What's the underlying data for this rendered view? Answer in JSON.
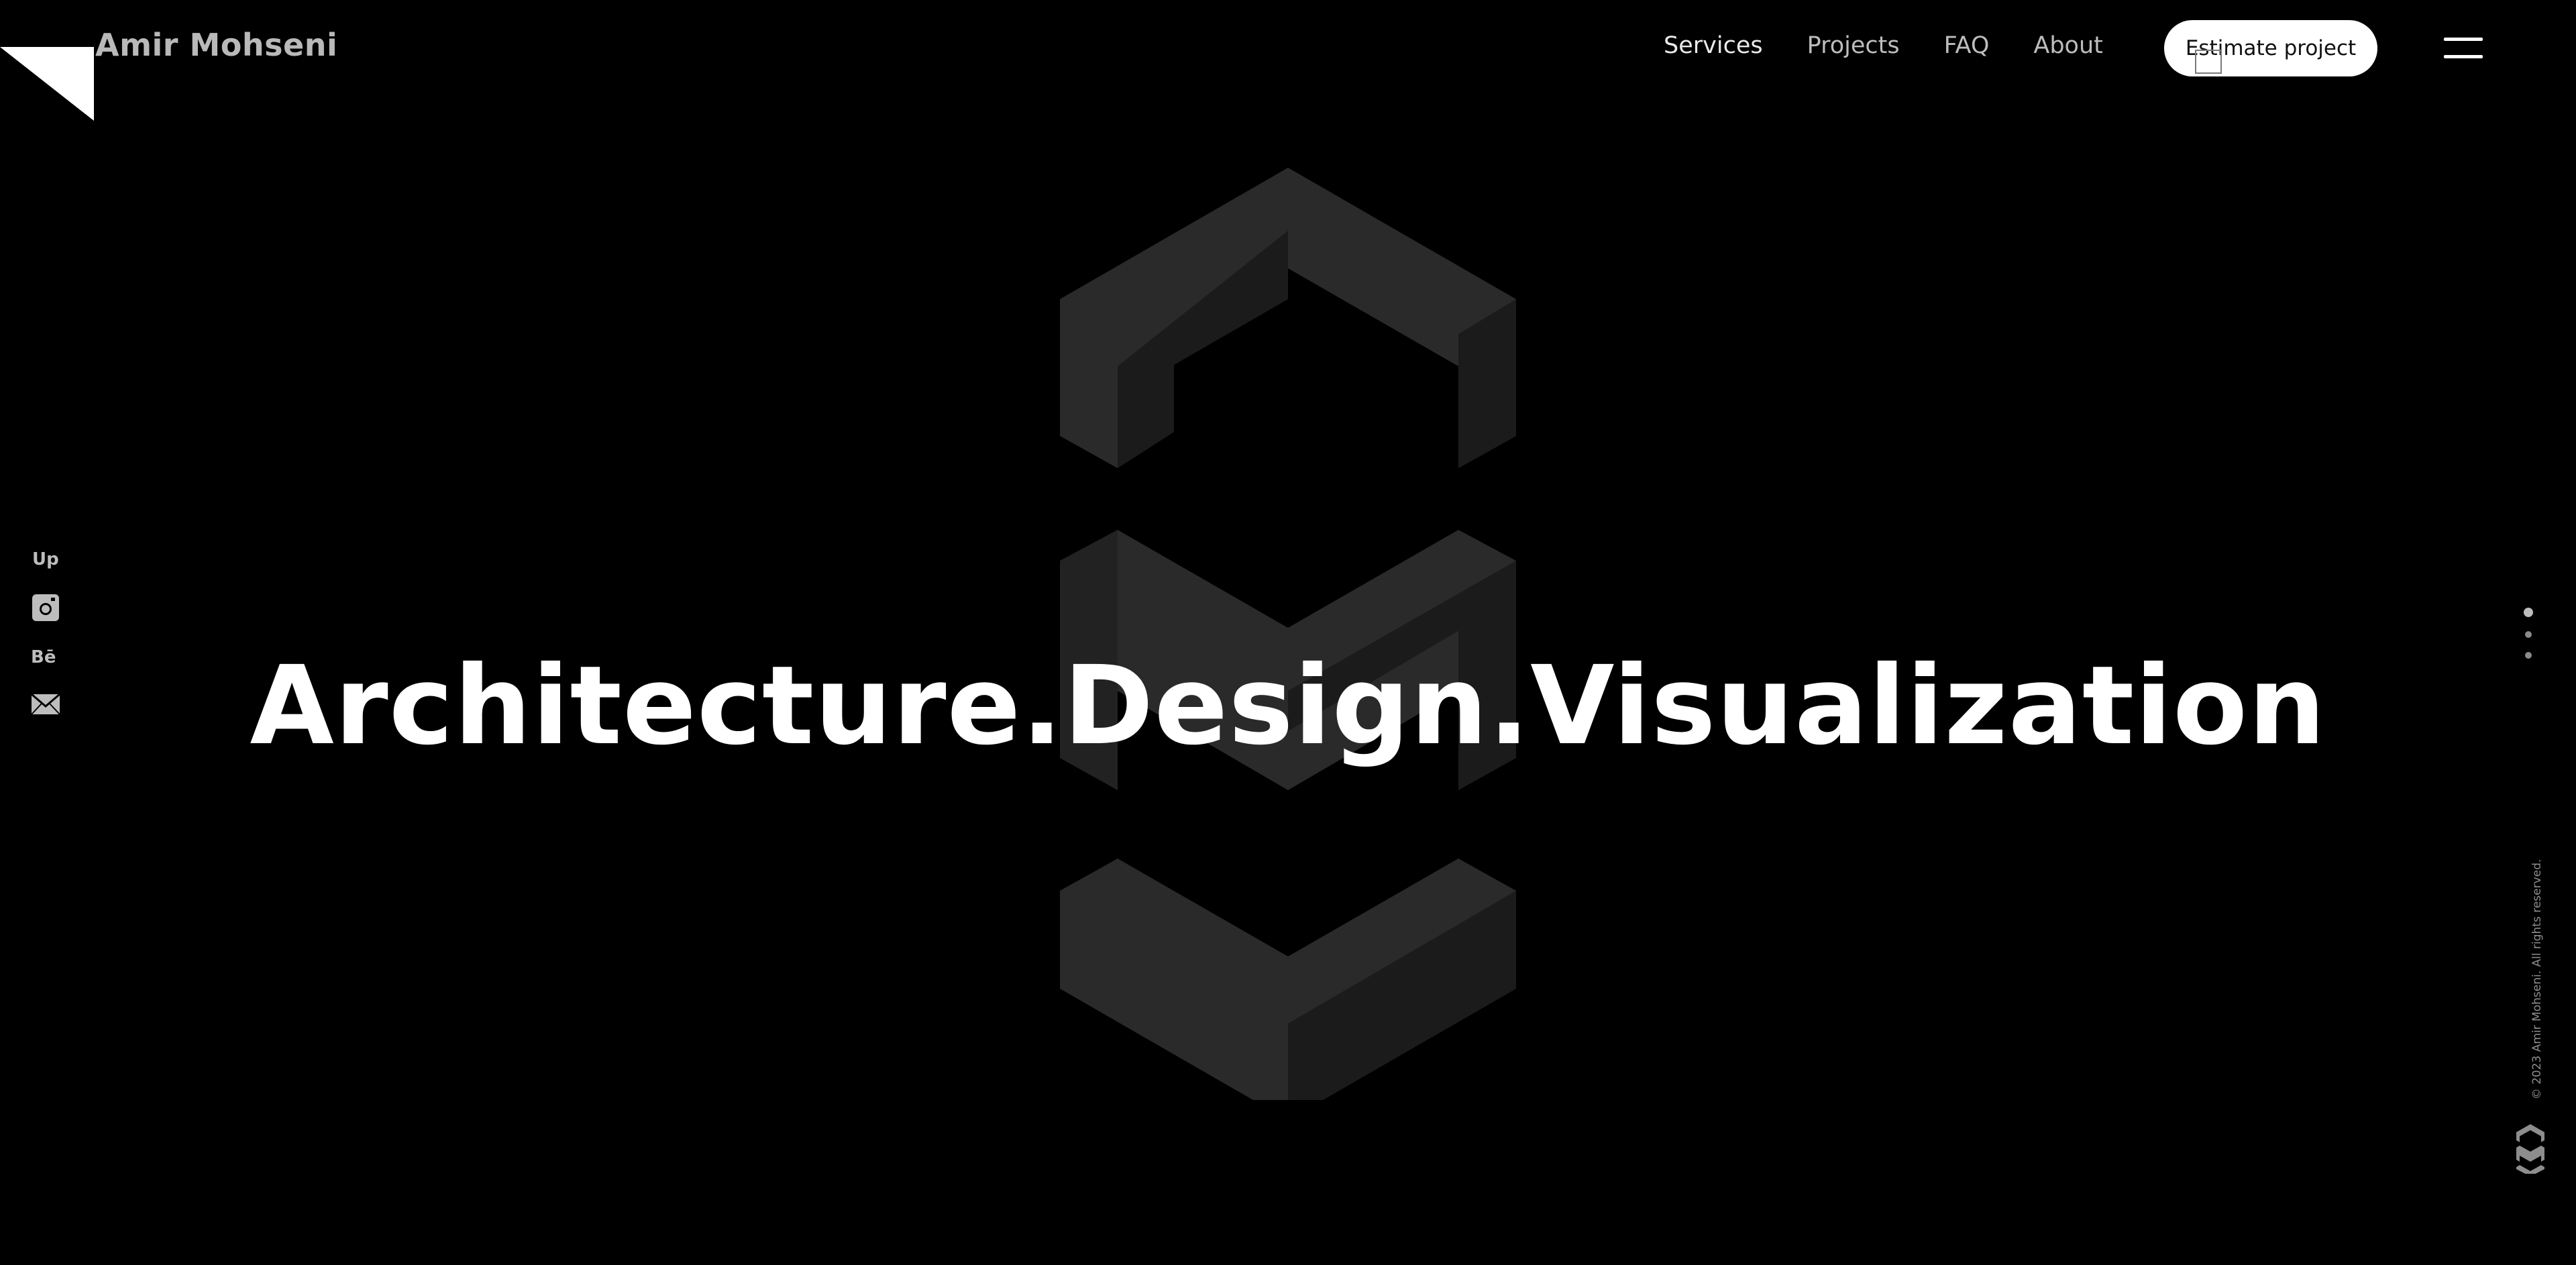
{
  "header": {
    "brand": "Amir Mohseni",
    "nav": [
      {
        "label": "Services"
      },
      {
        "label": "Projects"
      },
      {
        "label": "FAQ"
      },
      {
        "label": "About"
      }
    ],
    "cta_label": "Estimate project"
  },
  "hero": {
    "title": "Architecture.Design.Visualization"
  },
  "social": [
    {
      "icon": "upwork-icon",
      "label": "Up"
    },
    {
      "icon": "instagram-icon"
    },
    {
      "icon": "behance-icon",
      "label": "Bē"
    },
    {
      "icon": "mail-icon"
    }
  ],
  "pager": {
    "count": 3,
    "active_index": 0
  },
  "footer": {
    "copyright": "© 2023 Amir Mohseni. All rights reserved."
  },
  "colors": {
    "background": "#000000",
    "logo_face_light": "#2a2a2a",
    "logo_face_dark": "#1b1b1b",
    "text_primary": "#ffffff",
    "text_muted": "#bdbdbd"
  }
}
